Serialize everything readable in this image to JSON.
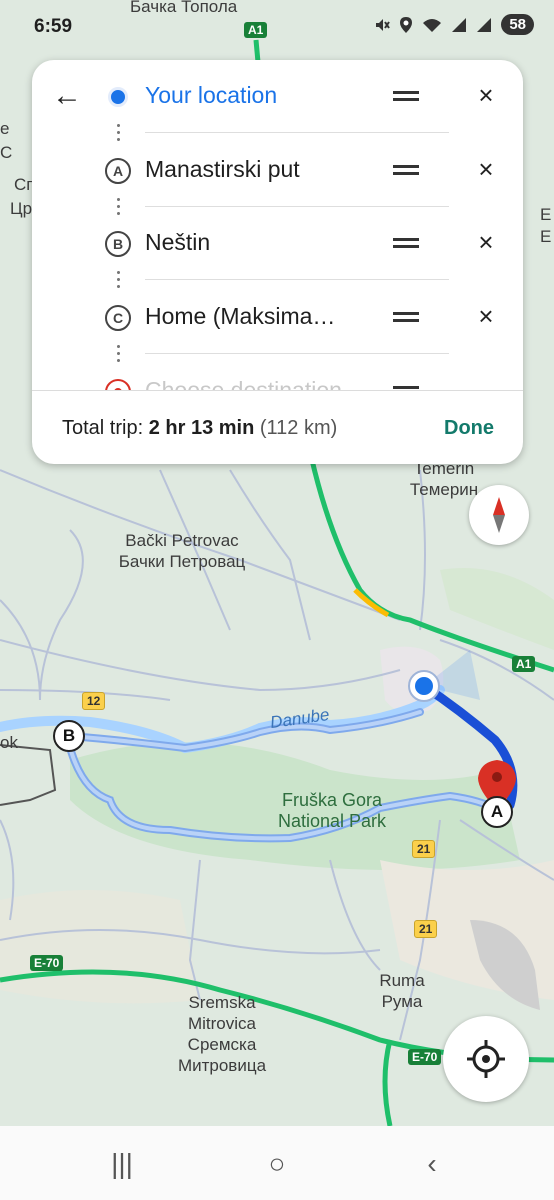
{
  "status_bar": {
    "time": "6:59",
    "battery": "58",
    "icons": [
      "mute-icon",
      "location-icon",
      "wifi-icon",
      "signal-icon",
      "signal-icon"
    ]
  },
  "directions_card": {
    "back_icon": "←",
    "stops": [
      {
        "marker": "",
        "label": "Your location",
        "type": "origin"
      },
      {
        "marker": "A",
        "label": "Manastirski put",
        "type": "waypoint"
      },
      {
        "marker": "B",
        "label": "Neštin",
        "type": "waypoint"
      },
      {
        "marker": "C",
        "label": "Home (Maksima…",
        "type": "waypoint"
      },
      {
        "marker": "",
        "label": "Choose destination",
        "type": "destination"
      }
    ],
    "remove_icon": "×",
    "trip": {
      "prefix": "Total trip: ",
      "time": "2 hr 13 min",
      "distance": " (112 km)"
    },
    "done_label": "Done"
  },
  "map": {
    "labels": {
      "backa_topola": "Бачка Топола",
      "temerin": "Temerin",
      "temerin_cyr": "Темерин",
      "backi_petrovac": "Bački Petrovac",
      "backi_petrovac_cyr": "Бачки Петровац",
      "danube": "Danube",
      "fruska_gora": "Fruška Gora National Park",
      "ruma": "Ruma",
      "ruma_cyr": "Рума",
      "sremska": "Sremska Mitrovica",
      "sremska_cyr": "Сремска Митровица",
      "left_ok": "ok",
      "left_e": "e",
      "left_c": "C",
      "left_cp": "Сг",
      "left_cr": "Цр",
      "right_e": "E",
      "right_b": "E"
    },
    "shields": {
      "a1_top": "A1",
      "a1_right": "A1",
      "r12": "12",
      "r21_a": "21",
      "r21_b": "21",
      "e70_left": "E-70",
      "e70_right": "E-70"
    },
    "route_markers": {
      "a": "A",
      "b": "B"
    },
    "colors": {
      "route": "#4285f4",
      "route_active": "#1a4fd6",
      "highway": "#1fbf6a",
      "water": "#a9d3ff",
      "land": "#dfe9e0",
      "forest": "#cfe6cf",
      "pin": "#d93025"
    }
  },
  "nav_bar": {
    "recents_icon": "|||",
    "home_icon": "○",
    "back_icon": "‹"
  }
}
